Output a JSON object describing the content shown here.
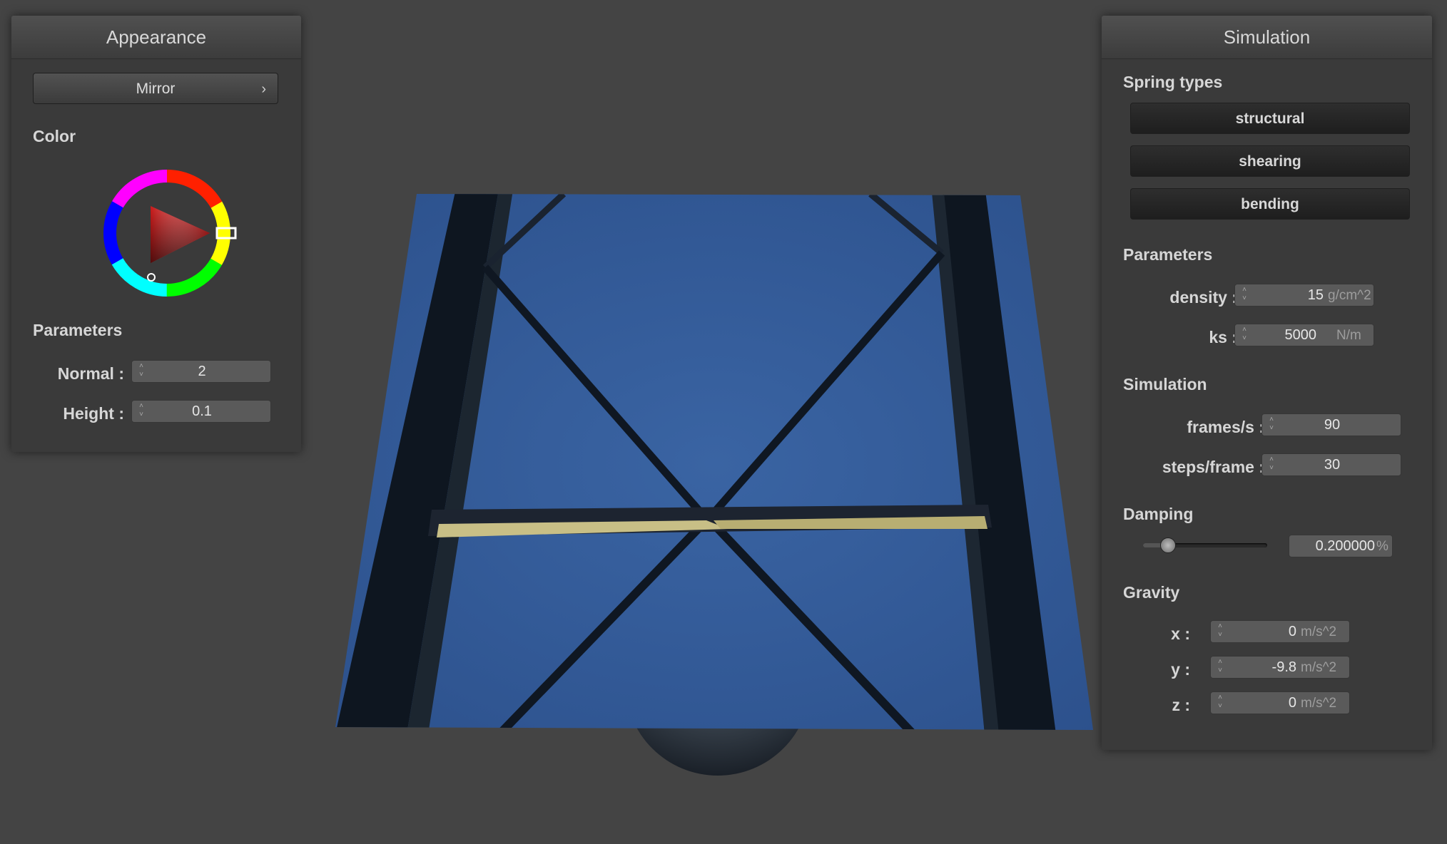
{
  "appearance": {
    "title": "Appearance",
    "shader_button": "Mirror",
    "color_label": "Color",
    "color_value": "#cc1a1a",
    "parameters_label": "Parameters",
    "normal_label": "Normal :",
    "normal_value": "2",
    "height_label": "Height :",
    "height_value": "0.1"
  },
  "simulation": {
    "title": "Simulation",
    "spring_types_label": "Spring types",
    "spring_types": [
      "structural",
      "shearing",
      "bending"
    ],
    "parameters_label": "Parameters",
    "density_label": "density :",
    "density_value": "15",
    "density_unit": "g/cm^2",
    "ks_label": "ks :",
    "ks_value": "5000",
    "ks_unit": "N/m",
    "sim_label": "Simulation",
    "fps_label": "frames/s :",
    "fps_value": "90",
    "steps_label": "steps/frame :",
    "steps_value": "30",
    "damping_label": "Damping",
    "damping_slider": 0.2,
    "damping_value": "0.200000",
    "damping_unit": "%",
    "gravity_label": "Gravity",
    "gx_label": "x :",
    "gx_value": "0",
    "gy_label": "y :",
    "gy_value": "-9.8",
    "gz_label": "z :",
    "gz_value": "0",
    "g_unit": "m/s^2"
  }
}
